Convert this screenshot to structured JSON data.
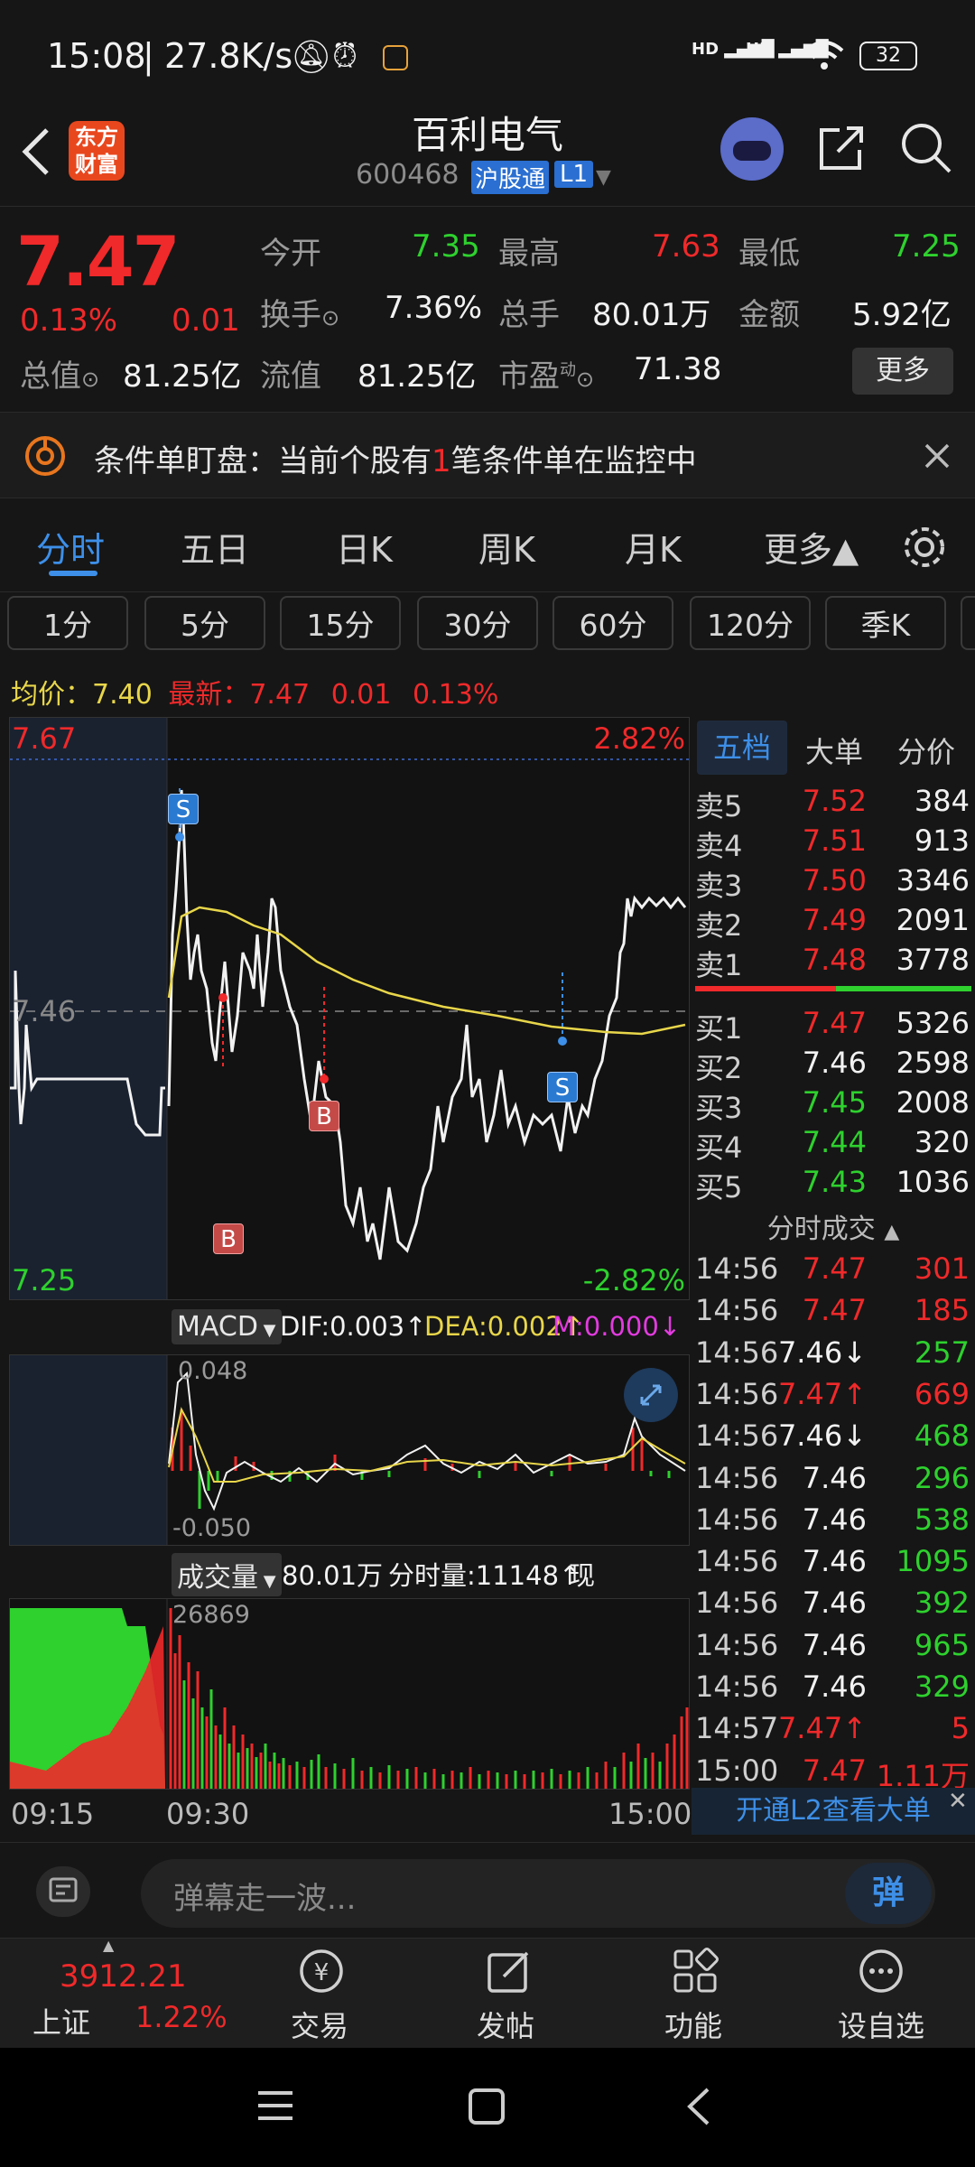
{
  "status": {
    "time": "15:08",
    "speed": "27.8K/s",
    "battery": "32",
    "net1": "HD",
    "net2": "HD"
  },
  "header": {
    "logo_line1": "东方",
    "logo_line2": "财富",
    "stock_name": "百利电气",
    "stock_code": "600468",
    "badge_hgt": "沪股通",
    "badge_level": "L1"
  },
  "quote": {
    "price": "7.47",
    "pct": "0.13%",
    "chg": "0.01",
    "open_label": "今开",
    "open": "7.35",
    "high_label": "最高",
    "high": "7.63",
    "low_label": "最低",
    "low": "7.25",
    "turnover_label": "换手",
    "turnover": "7.36%",
    "volume_label": "总手",
    "volume": "80.01万",
    "amount_label": "金额",
    "amount": "5.92亿",
    "mcap_label": "总值",
    "mcap": "81.25亿",
    "float_label": "流值",
    "float": "81.25亿",
    "pe_label": "市盈",
    "pe_sup": "动",
    "pe": "71.38",
    "more_button": "更多"
  },
  "condition_bar": {
    "text_pre": "条件单盯盘：当前个股有",
    "count": "1",
    "text_post": "笔条件单在监控中"
  },
  "tabs": [
    "分时",
    "五日",
    "日K",
    "周K",
    "月K",
    "更多▲"
  ],
  "periods": [
    "1分",
    "5分",
    "15分",
    "30分",
    "60分",
    "120分",
    "季K"
  ],
  "avg_line": {
    "avg_label": "均价：",
    "avg": "7.40",
    "latest_label": "最新：",
    "latest": "7.47",
    "chg": "0.01",
    "pct": "0.13%"
  },
  "chart": {
    "y_top": "7.67",
    "y_top_pct": "2.82%",
    "y_mid": "7.46",
    "y_bottom": "7.25",
    "y_bottom_pct": "-2.82%",
    "marker_s": "S",
    "marker_b": "B",
    "macd_label": "MACD",
    "dif": "DIF:0.003↑",
    "dea": "DEA:0.002↑",
    "m": "M:0.000↓",
    "macd_top": "0.048",
    "macd_bottom": "-0.050",
    "vol_label": "成交量",
    "vol_total": "80.01万",
    "vol_minute": "分时量:11148↑",
    "vol_now_label": "现量:",
    "vol_now": "11148",
    "vol_max": "26869",
    "t_start": "09:15",
    "t_open": "09:30",
    "t_end": "15:00"
  },
  "book": {
    "tabs": [
      "五档",
      "大单",
      "分价"
    ],
    "asks": [
      {
        "label": "卖5",
        "price": "7.52",
        "vol": "384"
      },
      {
        "label": "卖4",
        "price": "7.51",
        "vol": "913"
      },
      {
        "label": "卖3",
        "price": "7.50",
        "vol": "3346"
      },
      {
        "label": "卖2",
        "price": "7.49",
        "vol": "2091"
      },
      {
        "label": "卖1",
        "price": "7.48",
        "vol": "3778"
      }
    ],
    "bids": [
      {
        "label": "买1",
        "price": "7.47",
        "vol": "5326",
        "pc": "red"
      },
      {
        "label": "买2",
        "price": "7.46",
        "vol": "2598",
        "pc": "white"
      },
      {
        "label": "买3",
        "price": "7.45",
        "vol": "2008",
        "pc": "green"
      },
      {
        "label": "买4",
        "price": "7.44",
        "vol": "320",
        "pc": "green"
      },
      {
        "label": "买5",
        "price": "7.43",
        "vol": "1036",
        "pc": "green"
      }
    ],
    "ticks_title": "分时成交",
    "ticks": [
      {
        "t": "14:56",
        "p": "7.47",
        "v": "301",
        "pc": "red",
        "vc": "red"
      },
      {
        "t": "14:56",
        "p": "7.47",
        "v": "185",
        "pc": "red",
        "vc": "red"
      },
      {
        "t": "14:56",
        "p": "7.46↓",
        "v": "257",
        "pc": "white",
        "vc": "green"
      },
      {
        "t": "14:56",
        "p": "7.47↑",
        "v": "669",
        "pc": "red",
        "vc": "red"
      },
      {
        "t": "14:56",
        "p": "7.46↓",
        "v": "468",
        "pc": "white",
        "vc": "green"
      },
      {
        "t": "14:56",
        "p": "7.46",
        "v": "296",
        "pc": "white",
        "vc": "green"
      },
      {
        "t": "14:56",
        "p": "7.46",
        "v": "538",
        "pc": "white",
        "vc": "green"
      },
      {
        "t": "14:56",
        "p": "7.46",
        "v": "1095",
        "pc": "white",
        "vc": "green"
      },
      {
        "t": "14:56",
        "p": "7.46",
        "v": "392",
        "pc": "white",
        "vc": "green"
      },
      {
        "t": "14:56",
        "p": "7.46",
        "v": "965",
        "pc": "white",
        "vc": "green"
      },
      {
        "t": "14:56",
        "p": "7.46",
        "v": "329",
        "pc": "white",
        "vc": "green"
      },
      {
        "t": "14:57",
        "p": "7.47↑",
        "v": "5",
        "pc": "red",
        "vc": "red"
      },
      {
        "t": "15:00",
        "p": "7.47",
        "v": "1.11万",
        "pc": "red",
        "vc": "red"
      }
    ],
    "l2_link": "开通L2查看大单"
  },
  "danmu": {
    "placeholder": "弹幕走一波...",
    "send_label": "弹"
  },
  "bottom_nav": {
    "index_value": "3912.21",
    "index_name": "上证",
    "index_pct": "1.22%",
    "trade": "交易",
    "post": "发帖",
    "func": "功能",
    "watch": "设自选"
  },
  "colors": {
    "up": "#f0292a",
    "down": "#2ed12e",
    "avg_line": "#e8d64a",
    "accent": "#3d8fe8"
  }
}
